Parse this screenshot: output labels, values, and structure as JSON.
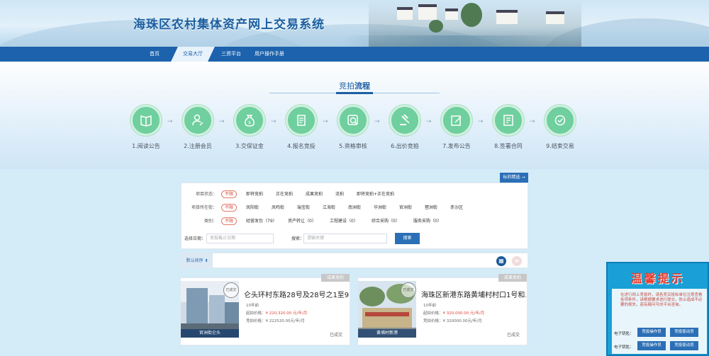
{
  "site_title": "海珠区农村集体资产网上交易系统",
  "nav": [
    "首页",
    "交易大厅",
    "三资平台",
    "用户操作手册"
  ],
  "process": {
    "title_a": "竞拍",
    "title_b": "流程",
    "steps": [
      {
        "label": "1.阅读公告",
        "icon": "book-icon"
      },
      {
        "label": "2.注册会员",
        "icon": "user-register-icon"
      },
      {
        "label": "3.交保证金",
        "icon": "money-bag-icon"
      },
      {
        "label": "4.报名竞投",
        "icon": "document-icon"
      },
      {
        "label": "5.资格审核",
        "icon": "magnifier-icon"
      },
      {
        "label": "6.出价竞拍",
        "icon": "gavel-icon"
      },
      {
        "label": "7.发布公告",
        "icon": "edit-icon"
      },
      {
        "label": "8.签署合同",
        "icon": "contract-icon"
      },
      {
        "label": "9.结束交易",
        "icon": "check-icon"
      }
    ]
  },
  "panel_head": "标的精选 →",
  "filters": {
    "status_key": "项目状态：",
    "status_opts": [
      "不限",
      "即将竞拍",
      "正在竞拍",
      "成果竞拍",
      "流拍",
      "即将竞拍+正在竞拍"
    ],
    "region_key": "项目所在街：",
    "region_opts": [
      "不限",
      "凤阳街",
      "凤鸣街",
      "瑞宝街",
      "江海街",
      "南洲街",
      "华洲街",
      "官洲街",
      "琶洲街",
      "赤沙区"
    ],
    "type_key": "类别：",
    "type_opts": [
      "不限",
      "经营发包（79）",
      "资产转让（0）",
      "工程建设（0）",
      "综合采购（0）",
      "服务采购（0）"
    ],
    "date_label": "选择日期：",
    "date_placeholder": "竞投截止日期",
    "search_label": "搜索：",
    "search_placeholder": "请输关键",
    "search_btn": "搜索"
  },
  "sortbar": {
    "sort_label": "默认排序 ⬍",
    "grid_icon": "grid-icon",
    "list_icon": "list-icon"
  },
  "cards": [
    {
      "title": "仑头环村东路28号及28号之1至9",
      "ribbon": "成果竞拍",
      "thumb_cap": "官洲街仑头",
      "stamp": "已成交",
      "code": "10年前",
      "price_label": "起拍价格：",
      "price": "¥ 220,320.00 元/年/月",
      "deal_label": "竞拍价格：",
      "deal": "¥ 222520.00元/年/月",
      "status": "已成交"
    },
    {
      "title": "海珠区新港东路黄埔村村口1号和...",
      "ribbon": "成果竞拍",
      "thumb_cap": "黄埔村新港",
      "stamp": "已成交",
      "code": "10年前",
      "price_label": "起拍价格：",
      "price": "¥ 320,000.00 元/年/月",
      "deal_label": "竞拍价格：",
      "deal": "¥ 320000.00元/年/月",
      "status": "已成交"
    }
  ],
  "tip": {
    "title": "温馨提示",
    "text": "在进行网上竞投时，请各竞买投标单位注意查看各项条件，请根据要求进行提交，防止造成不必要的损失，若有疑问可向平台咨询。",
    "row1_label": "电子钥匙：",
    "row2_label": "电子钥匙：",
    "btn1": "竞投操作员",
    "btn2": "竞投驱动员",
    "btn3": "竞投操作员",
    "btn4": "竞投驱动员"
  },
  "colors": {
    "brand": "#1c62ac",
    "step": "#6fcf9e",
    "accent_red": "#d9483a",
    "tip_bg": "#1aa0d6"
  }
}
